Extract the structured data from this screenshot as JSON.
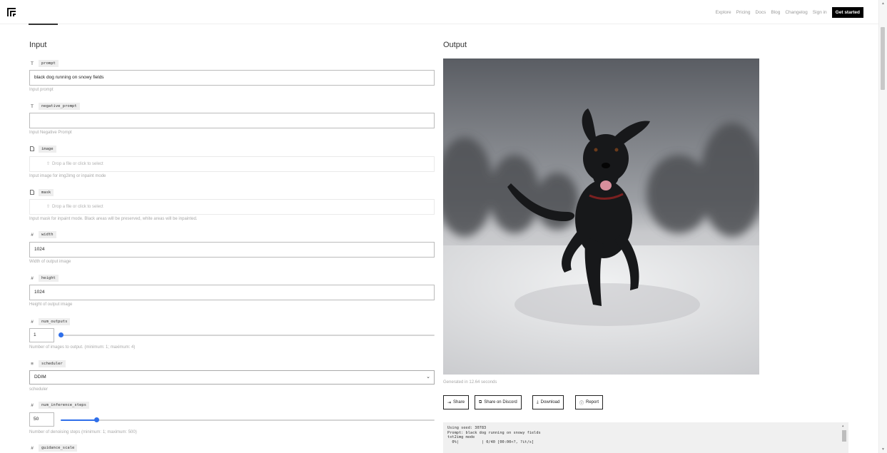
{
  "nav": {
    "items": [
      "Explore",
      "Pricing",
      "Docs",
      "Blog",
      "Changelog",
      "Sign in"
    ],
    "cta": "Get started"
  },
  "input": {
    "title": "Input",
    "prompt": {
      "label": "prompt",
      "value": "black dog running on snowy fields",
      "help": "Input prompt"
    },
    "negative_prompt": {
      "label": "negative_prompt",
      "value": "",
      "help": "Input Negative Prompt"
    },
    "image": {
      "label": "image",
      "placeholder": "Drop a file or click to select",
      "help": "Input image for img2img or inpaint mode"
    },
    "mask": {
      "label": "mask",
      "placeholder": "Drop a file or click to select",
      "help": "Input mask for inpaint mode. Black areas will be preserved, white areas will be inpainted."
    },
    "width": {
      "label": "width",
      "value": "1024",
      "help": "Width of output image"
    },
    "height": {
      "label": "height",
      "value": "1024",
      "help": "Height of output image"
    },
    "num_outputs": {
      "label": "num_outputs",
      "value": "1",
      "help": "Number of images to output. (minimum: 1; maximum: 4)",
      "min": 1,
      "max": 4
    },
    "scheduler": {
      "label": "scheduler",
      "value": "DDIM",
      "help": "scheduler"
    },
    "num_inference_steps": {
      "label": "num_inference_steps",
      "value": "50",
      "help": "Number of denoising steps (minimum: 1; maximum: 500)",
      "min": 1,
      "max": 500
    },
    "guidance_scale": {
      "label": "guidance_scale"
    }
  },
  "output": {
    "title": "Output",
    "generated": "Generated in 12.64 seconds",
    "buttons": {
      "share": "Share",
      "discord": "Share on Discord",
      "download": "Download",
      "report": "Report"
    },
    "log": [
      "Using seed: 30783",
      "Prompt: black dog running on snowy fields",
      "txt2img mode",
      "  0%|          | 0/40 [00:00<?, ?it/s]"
    ]
  },
  "icons": {
    "text_field": "T",
    "file_field": "file-icon",
    "number_field": "#",
    "select_field": "list-icon",
    "upload": "upload-icon"
  },
  "colors": {
    "accent": "#2f6fea",
    "cta_bg": "#000000"
  }
}
